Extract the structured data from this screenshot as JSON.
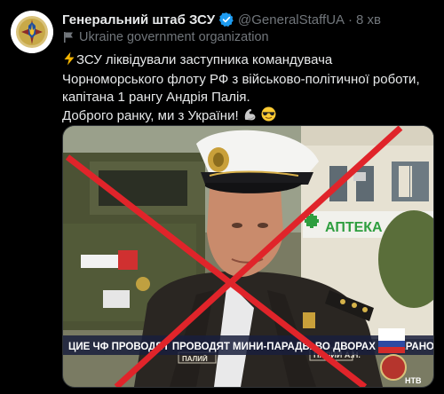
{
  "account": {
    "name": "Генеральний штаб ЗСУ",
    "handle": "@GeneralStaffUA",
    "separator": "·",
    "time": "8 хв",
    "label": "Ukraine government organization"
  },
  "tweet": {
    "line1": "ЗСУ ліквідували заступника командувача Чорноморського флоту РФ з військово-політичної роботи, капітана 1 рангу Андрія Палія.",
    "line2": "Доброго ранку, ми з України!"
  },
  "media": {
    "sign": "АПТЕКА",
    "ticker": "ЦИЕ ЧФ ПРОВОДЯТ ПРОВОДЯТ МИНИ-ПАРАДЫ ВО ДВОРАХ ВЕТЕРАНОВ",
    "name_tag_left": "ПАЛИЙ",
    "name_tag_right": "ПАЛИЙ А.Н.",
    "corner": "НТВ",
    "cross_color": "#e0242a"
  },
  "colors": {
    "verified": "#1d9bf0",
    "muted": "#71767b",
    "text": "#e7e9ea"
  }
}
